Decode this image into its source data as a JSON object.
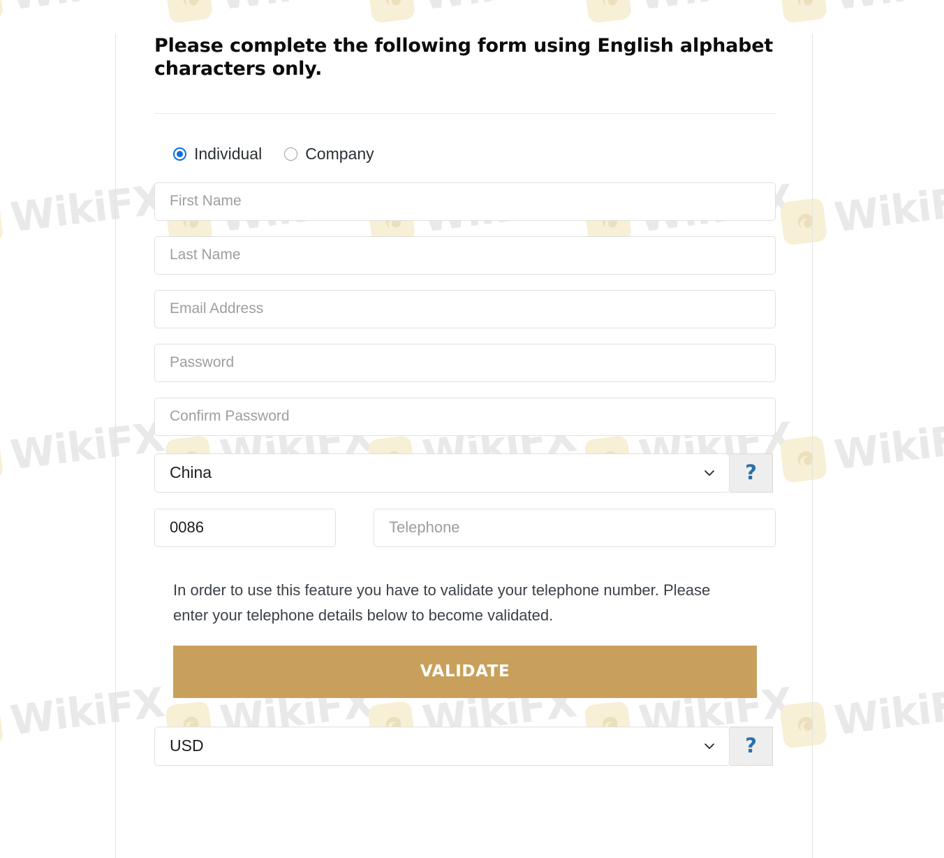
{
  "form": {
    "heading": "Please complete the following form using English alphabet characters only.",
    "account_type": {
      "options": [
        {
          "label": "Individual",
          "selected": true
        },
        {
          "label": "Company",
          "selected": false
        }
      ]
    },
    "fields": {
      "first_name_placeholder": "First Name",
      "last_name_placeholder": "Last Name",
      "email_placeholder": "Email Address",
      "password_placeholder": "Password",
      "confirm_password_placeholder": "Confirm Password",
      "dial_code_value": "0086",
      "telephone_placeholder": "Telephone"
    },
    "country_select": {
      "value": "China",
      "help_label": "?",
      "chevron_icon": "chevron-down-icon"
    },
    "currency_select": {
      "value": "USD",
      "help_label": "?",
      "chevron_icon": "chevron-down-icon"
    },
    "validate": {
      "note": "In order to use this feature you have to validate your telephone number. Please enter your telephone details below to become validated.",
      "button_label": "VALIDATE"
    }
  },
  "watermark": {
    "text": "WikiFX",
    "logo_icon": "wikifx-bird-logo-icon"
  },
  "colors": {
    "accent_radio": "#0a70e0",
    "validate_button": "#c9a05b",
    "help_icon": "#2f6fa8",
    "border": "#e0e0e0",
    "placeholder": "#9e9e9e",
    "heading_text": "#0c0c0c"
  }
}
